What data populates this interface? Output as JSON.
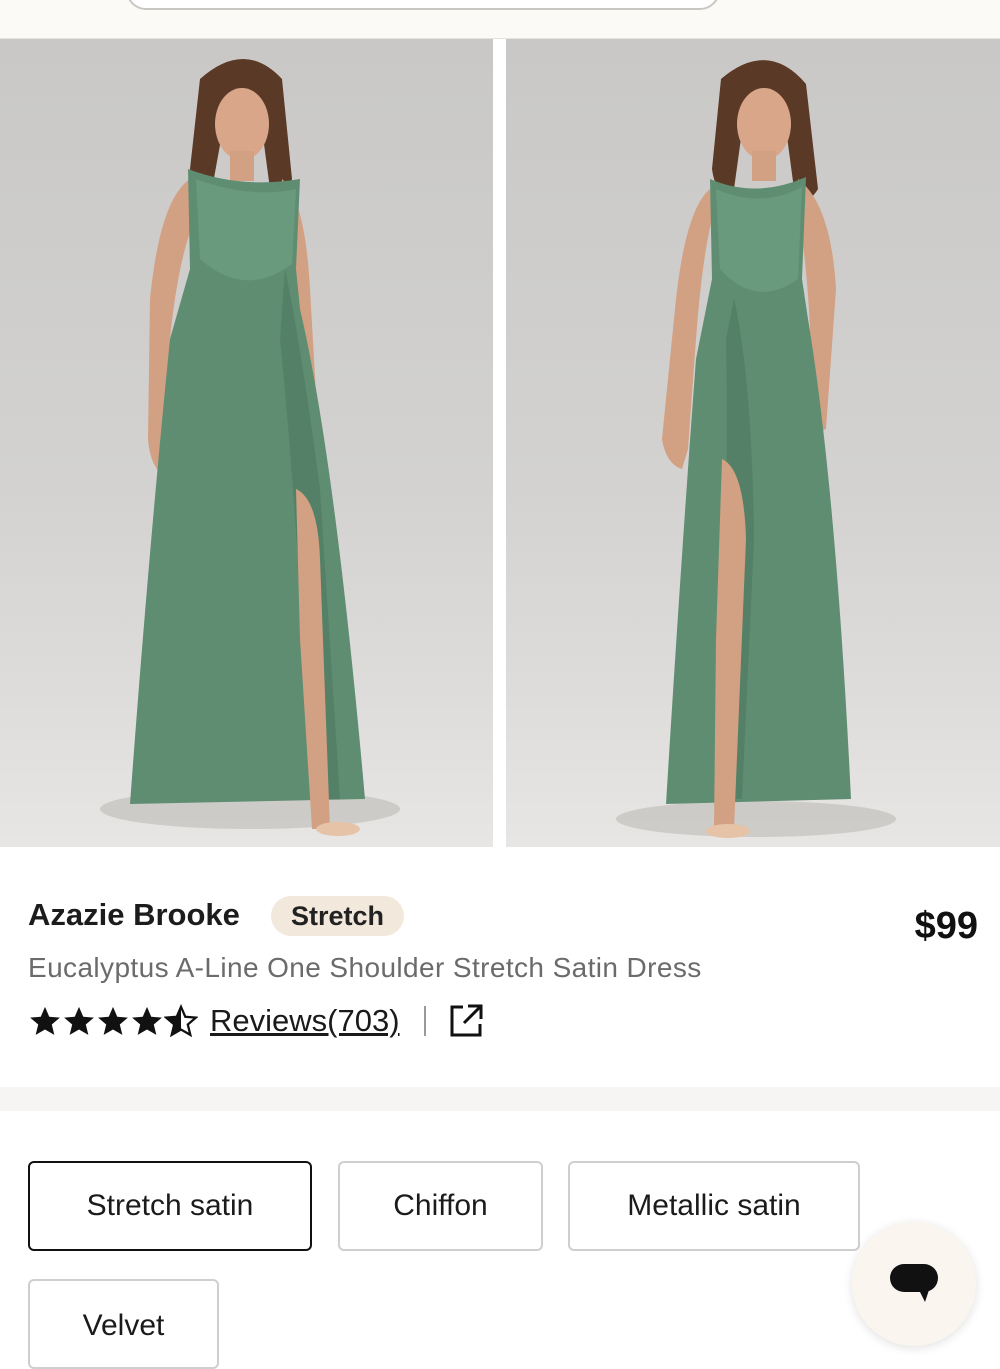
{
  "header": {
    "search_placeholder": ""
  },
  "gallery": {
    "images": [
      "front-view-photo",
      "three-quarter-view-photo"
    ],
    "favorite_icon": "heart-icon"
  },
  "product": {
    "brand_name": "Azazie Brooke",
    "badge": "Stretch",
    "price": "$99",
    "subtitle": "Eucalyptus A-Line One Shoulder Stretch Satin Dress",
    "rating": 4.5,
    "rating_max": 5,
    "reviews_label": "Reviews(703)",
    "share_icon": "external-link-icon"
  },
  "fabrics": {
    "options": [
      "Stretch satin",
      "Chiffon",
      "Metallic satin",
      "Velvet"
    ],
    "selected": "Stretch satin"
  },
  "chat": {
    "icon": "chat-bubble-icon"
  },
  "colors": {
    "dress_green": "#5f8d72",
    "badge_bg": "#f2e8dc",
    "selected_border": "#111111",
    "muted_text": "#6b6b6b"
  }
}
